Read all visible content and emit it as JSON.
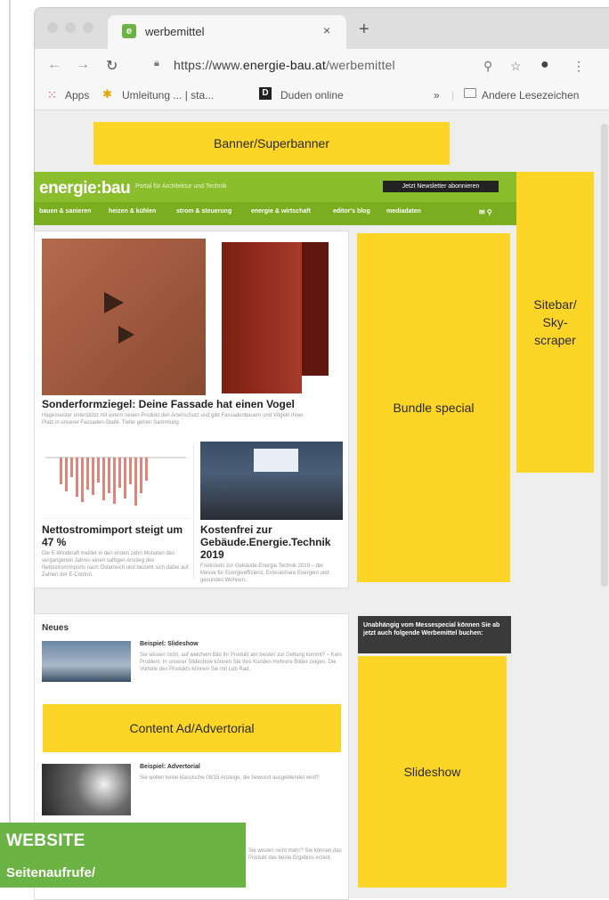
{
  "browser": {
    "tab_title": "werbemittel",
    "favicon_letter": "e",
    "new_tab": "+",
    "close": "×",
    "url_prefix": "https://www.",
    "url_domain": "energie-bau.at",
    "url_path": "/werbemittel",
    "bookmarks": {
      "apps": "Apps",
      "umleitung": "Umleitung ... | sta...",
      "duden_icon": "D",
      "duden": "Duden online",
      "overflow": "»",
      "andere": "Andere Lesezeichen"
    }
  },
  "ads": {
    "banner": "Banner/Superbanner",
    "sitebar_line1": "Sitebar/",
    "sitebar_line2": "Sky-",
    "sitebar_line3": "scraper",
    "bundle": "Bundle special",
    "content_ad": "Content Ad/Advertorial",
    "slideshow": "Slideshow"
  },
  "site": {
    "logo": "energie:bau",
    "tagline": "Portal für Architektur und Technik",
    "subscribe": "Jetzt Newsletter abonnieren",
    "nav": [
      "bauen & sanieren",
      "heizen & kühlen",
      "strom & steuerung",
      "energie & wirtschaft",
      "editor's blog",
      "mediadaten"
    ]
  },
  "articles": {
    "main_title": "Sonderformziegel: Deine Fassade hat einen Vogel",
    "main_text": "Hagemeister unterstützt mit einem neuen Produkt den Artenschutz und gibt Fassadenbauern und Vögeln ihren Platz in unserer Fassaden-Statik. Tiefer gehen Sammlung.",
    "a2_title": "Nettostromimport steigt um 47 %",
    "a2_text": "Die E-Windkraft meldet in den ersten zehn Monaten des vergangenen Jahres einen saftigen Anstieg des Nettostromimports nach Österreich und bezieht sich dabei auf Zahlen der E-Control.",
    "a3_title": "Kostenfrei zur Gebäude.Energie.Technik 2019",
    "a3_text": "Freitickets zur Gebäude.Energie.Technik 2019 – der Messe für Energieeffizienz, Erneuerbare Energien und gesundes Wohnen."
  },
  "news": {
    "heading": "Neues",
    "item1_title": "Beispiel: Slideshow",
    "item1_text": "Sie wissen nicht, auf welchem Bild Ihr Produkt am besten zur Geltung kommt? – Kein Problem: In unserer Slideshow können Sie Ihre Kunden mehrere Bilder zeigen. Die Vorteile des Produkts können Sie mit Lob Rad.",
    "item2_title": "Beispiel: Advertorial",
    "item2_text": "Sie wollen keine klassische 08/15 Anzeige, die bewusst ausgeblendet wird?",
    "item3_text": "Sie wissen nicht mehr? Sie können das Produkt das beste Ergebnis erzielt."
  },
  "dark_notice": "Unabhängig vom Messespecial können Sie ab jetzt auch folgende Werbemittel buchen:",
  "label": {
    "website": "WEBSITE",
    "seitenaufrufe": "Seitenaufrufe/"
  },
  "colors": {
    "ad_yellow": "#fdd527",
    "site_green": "#8bbe2c",
    "label_green": "#6ab344"
  }
}
